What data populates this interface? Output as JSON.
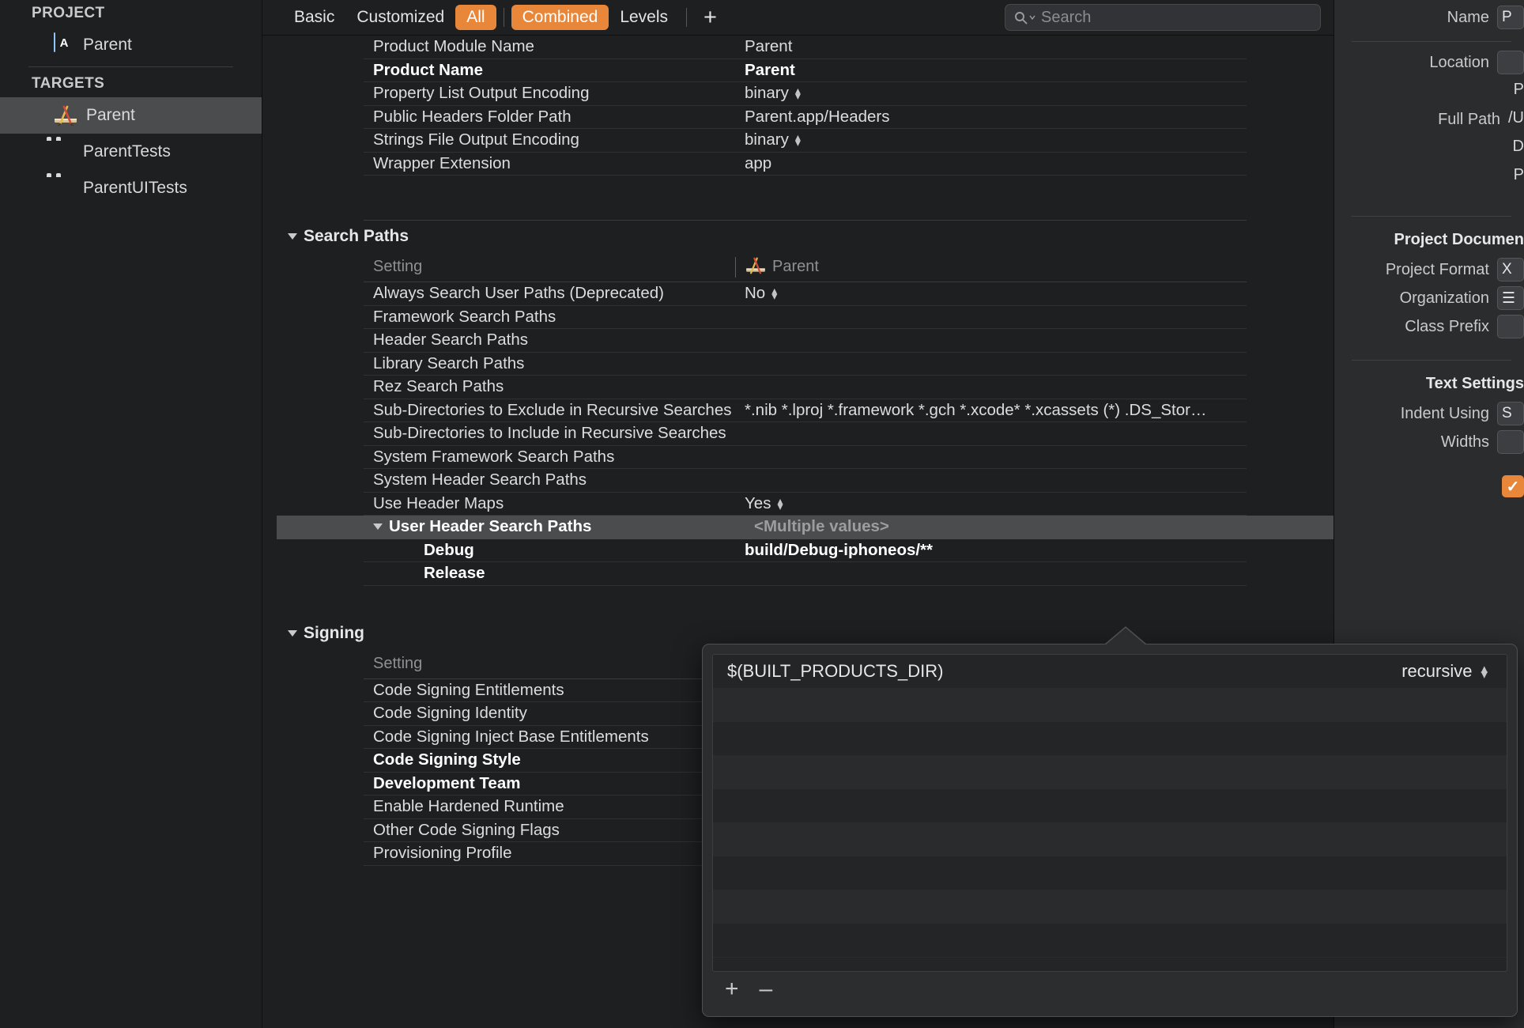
{
  "sidebar": {
    "project_header": "PROJECT",
    "project_items": [
      {
        "label": "Parent",
        "icon": "project-document-icon"
      }
    ],
    "targets_header": "TARGETS",
    "target_items": [
      {
        "label": "Parent",
        "icon": "app-target-icon",
        "selected": true
      },
      {
        "label": "ParentTests",
        "icon": "test-bundle-icon",
        "selected": false
      },
      {
        "label": "ParentUITests",
        "icon": "test-bundle-icon",
        "selected": false
      }
    ]
  },
  "toolbar": {
    "filters": [
      {
        "label": "Basic",
        "active": false
      },
      {
        "label": "Customized",
        "active": false
      },
      {
        "label": "All",
        "active": true
      }
    ],
    "modes": [
      {
        "label": "Combined",
        "active": true
      },
      {
        "label": "Levels",
        "active": false
      }
    ],
    "add_label": "+",
    "search_placeholder": "Search",
    "accent_color": "#e8863a"
  },
  "settings": {
    "top_rows": [
      {
        "name": "Product Module Name",
        "value": "Parent",
        "bold": false,
        "stepper": false
      },
      {
        "name": "Product Name",
        "value": "Parent",
        "bold": true,
        "stepper": false
      },
      {
        "name": "Property List Output Encoding",
        "value": "binary",
        "bold": false,
        "stepper": true
      },
      {
        "name": "Public Headers Folder Path",
        "value": "Parent.app/Headers",
        "bold": false,
        "stepper": false
      },
      {
        "name": "Strings File Output Encoding",
        "value": "binary",
        "bold": false,
        "stepper": true
      },
      {
        "name": "Wrapper Extension",
        "value": "app",
        "bold": false,
        "stepper": false
      }
    ],
    "search_paths": {
      "group_title": "Search Paths",
      "col_setting": "Setting",
      "col_target": "Parent",
      "rows": [
        {
          "name": "Always Search User Paths (Deprecated)",
          "value": "No",
          "bold": false,
          "stepper": true
        },
        {
          "name": "Framework Search Paths",
          "value": "",
          "bold": false,
          "stepper": false
        },
        {
          "name": "Header Search Paths",
          "value": "",
          "bold": false,
          "stepper": false
        },
        {
          "name": "Library Search Paths",
          "value": "",
          "bold": false,
          "stepper": false
        },
        {
          "name": "Rez Search Paths",
          "value": "",
          "bold": false,
          "stepper": false
        },
        {
          "name": "Sub-Directories to Exclude in Recursive Searches",
          "value": "*.nib *.lproj *.framework *.gch *.xcode* *.xcassets (*) .DS_Stor…",
          "bold": false,
          "stepper": false
        },
        {
          "name": "Sub-Directories to Include in Recursive Searches",
          "value": "",
          "bold": false,
          "stepper": false
        },
        {
          "name": "System Framework Search Paths",
          "value": "",
          "bold": false,
          "stepper": false
        },
        {
          "name": "System Header Search Paths",
          "value": "",
          "bold": false,
          "stepper": false
        },
        {
          "name": "Use Header Maps",
          "value": "Yes",
          "bold": false,
          "stepper": true
        }
      ],
      "expanded_row": {
        "name": "User Header Search Paths",
        "value": "<Multiple values>"
      },
      "expanded_children": [
        {
          "name": "Debug",
          "value": "build/Debug-iphoneos/**"
        },
        {
          "name": "Release",
          "value": ""
        }
      ]
    },
    "signing": {
      "group_title": "Signing",
      "col_setting": "Setting",
      "rows": [
        {
          "name": "Code Signing Entitlements",
          "bold": false
        },
        {
          "name": "Code Signing Identity",
          "bold": false
        },
        {
          "name": "Code Signing Inject Base Entitlements",
          "bold": false
        },
        {
          "name": "Code Signing Style",
          "bold": true
        },
        {
          "name": "Development Team",
          "bold": true
        },
        {
          "name": "Enable Hardened Runtime",
          "bold": false
        },
        {
          "name": "Other Code Signing Flags",
          "bold": false
        },
        {
          "name": "Provisioning Profile",
          "bold": false
        }
      ]
    }
  },
  "popover": {
    "rows": [
      {
        "value": "$(BUILT_PRODUCTS_DIR)",
        "mode": "recursive"
      },
      {
        "value": "",
        "mode": ""
      },
      {
        "value": "",
        "mode": ""
      },
      {
        "value": "",
        "mode": ""
      },
      {
        "value": "",
        "mode": ""
      },
      {
        "value": "",
        "mode": ""
      },
      {
        "value": "",
        "mode": ""
      },
      {
        "value": "",
        "mode": ""
      },
      {
        "value": "",
        "mode": ""
      }
    ],
    "add_label": "+",
    "remove_label": "–"
  },
  "inspector": {
    "identity_rows": [
      {
        "label": "Name",
        "value": "P"
      },
      {
        "label": "Location",
        "value": ""
      },
      {
        "label": "",
        "value": "P"
      },
      {
        "label": "Full Path",
        "value": "/U"
      },
      {
        "label": "",
        "value": "D"
      },
      {
        "label": "",
        "value": "P"
      }
    ],
    "project_document": {
      "header": "Project Documen",
      "rows": [
        {
          "label": "Project Format",
          "value": "X"
        },
        {
          "label": "Organization",
          "value": "☰"
        },
        {
          "label": "Class Prefix",
          "value": ""
        }
      ]
    },
    "text_settings": {
      "header": "Text Settings",
      "rows": [
        {
          "label": "Indent Using",
          "value": "S"
        },
        {
          "label": "Widths",
          "value": ""
        }
      ]
    },
    "checkbox_checked": true
  }
}
